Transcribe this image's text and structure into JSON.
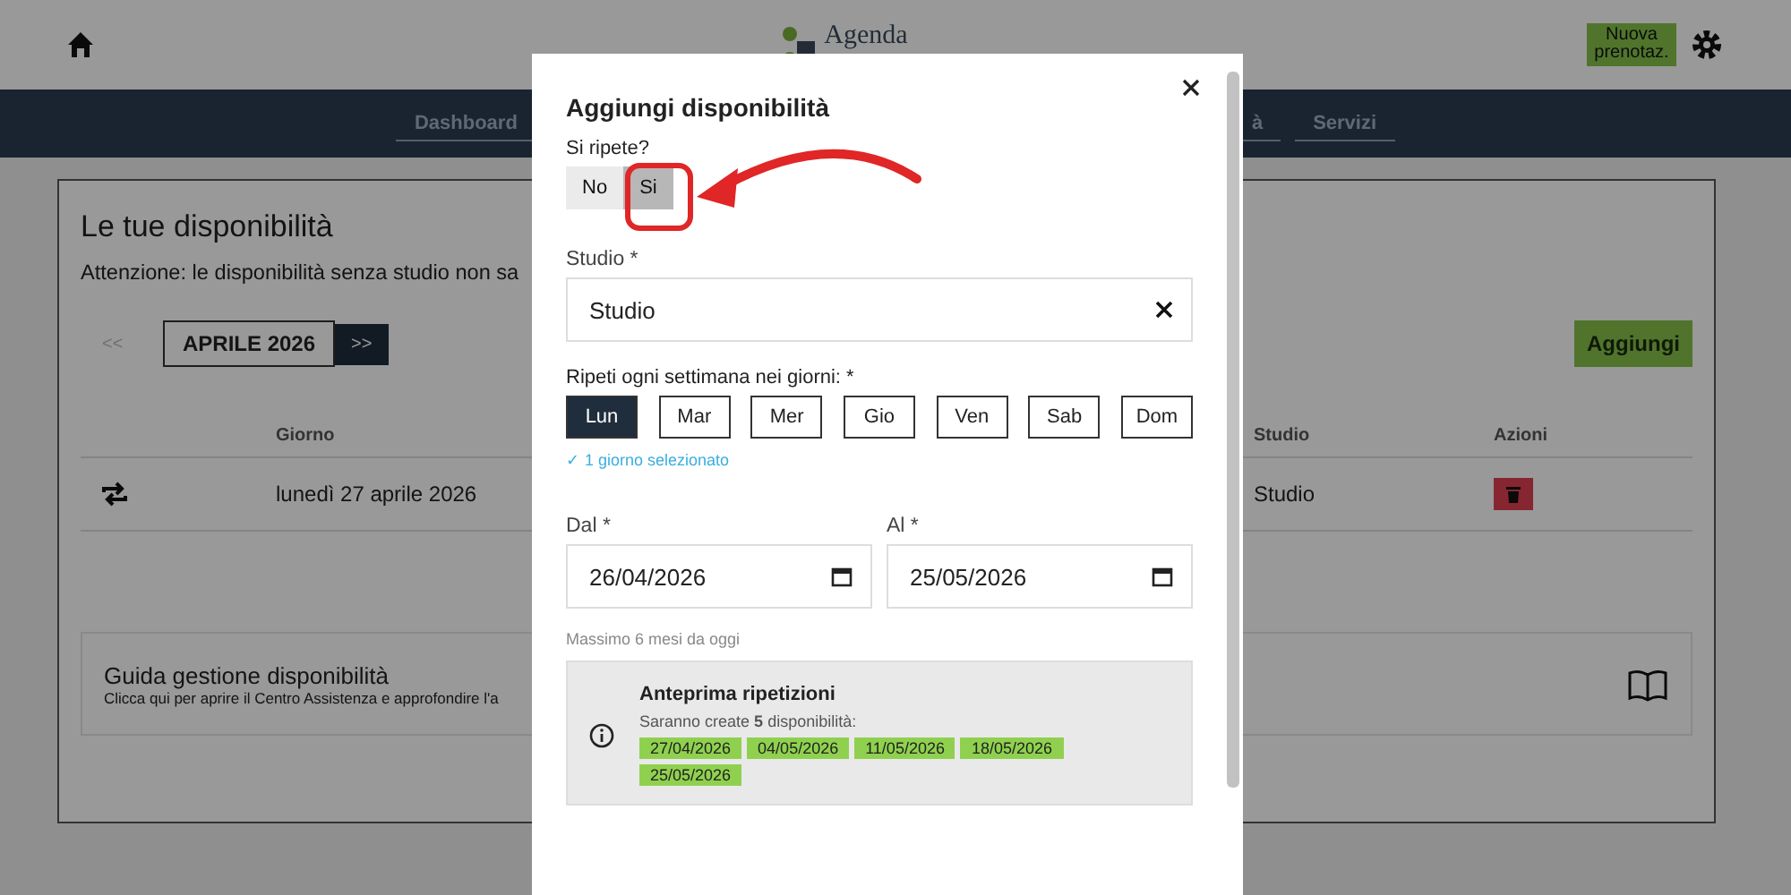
{
  "header": {
    "logo_lines": [
      "Agenda"
    ],
    "new_booking_button": "Nuova prenotaz."
  },
  "nav": {
    "items": [
      {
        "label": "Dashboard"
      },
      {
        "label": "à"
      },
      {
        "label": "Servizi"
      }
    ]
  },
  "page": {
    "title": "Le tue disponibilità",
    "warning": "Attenzione: le disponibilità senza studio non sa",
    "month_nav": {
      "prev": "<<",
      "prev_disabled": true,
      "month": "APRILE 2026",
      "next": ">>"
    },
    "add_button": "Aggiungi",
    "table": {
      "columns": [
        "Giorno",
        "Studio",
        "Azioni"
      ],
      "rows": [
        {
          "repeating": true,
          "day": "lunedì 27 aprile 2026",
          "studio": "Studio"
        }
      ]
    },
    "guide": {
      "title": "Guida gestione disponibilità",
      "text": "Clicca qui per aprire il Centro Assistenza e approfondire l'a"
    }
  },
  "dialog": {
    "title": "Aggiungi disponibilità",
    "repeat_label": "Si ripete?",
    "repeat_options": [
      {
        "label": "No",
        "selected": false
      },
      {
        "label": "Si",
        "selected": true
      }
    ],
    "studio_label": "Studio *",
    "studio_value": "Studio",
    "days_label": "Ripeti ogni settimana nei giorni: *",
    "days": [
      {
        "label": "Lun",
        "selected": true
      },
      {
        "label": "Mar",
        "selected": false
      },
      {
        "label": "Mer",
        "selected": false
      },
      {
        "label": "Gio",
        "selected": false
      },
      {
        "label": "Ven",
        "selected": false
      },
      {
        "label": "Sab",
        "selected": false
      },
      {
        "label": "Dom",
        "selected": false
      }
    ],
    "days_hint": "✓ 1 giorno selezionato",
    "from_label": "Dal *",
    "from_value": "26/04/2026",
    "to_label": "Al *",
    "to_value": "25/05/2026",
    "range_hint": "Massimo 6 mesi da oggi",
    "preview": {
      "title": "Anteprima ripetizioni",
      "summary": "Saranno create **5** disponibilità:",
      "dates": [
        "27/04/2026",
        "04/05/2026",
        "11/05/2026",
        "18/05/2026",
        "25/05/2026"
      ]
    }
  }
}
